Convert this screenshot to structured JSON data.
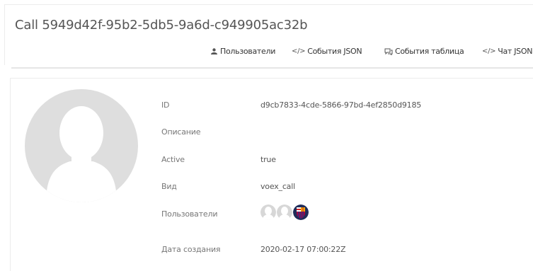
{
  "header": {
    "title": "Call 5949d42f-95b2-5db5-9a6d-c949905ac32b",
    "tabs": [
      {
        "label": "Пользователи",
        "icon": "users-icon"
      },
      {
        "label": "События JSON",
        "icon": "code-icon"
      },
      {
        "label": "События таблица",
        "icon": "comments-icon"
      },
      {
        "label": "Чат JSON",
        "icon": "code-icon"
      }
    ]
  },
  "details": {
    "avatar_icon": "user-placeholder-avatar",
    "fields": [
      {
        "label": "ID",
        "value": "d9cb7833-4cde-5866-97bd-4ef2850d9185"
      },
      {
        "label": "Описание",
        "value": ""
      },
      {
        "label": "Active",
        "value": "true"
      },
      {
        "label": "Вид",
        "value": "voex_call"
      },
      {
        "label": "Пользователи",
        "value": ""
      },
      {
        "label": "Дата создания",
        "value": "2020-02-17 07:00:22Z"
      }
    ],
    "users": [
      {
        "avatar": "default-user-avatar"
      },
      {
        "avatar": "default-user-avatar"
      },
      {
        "avatar": "club-crest-avatar"
      }
    ]
  }
}
